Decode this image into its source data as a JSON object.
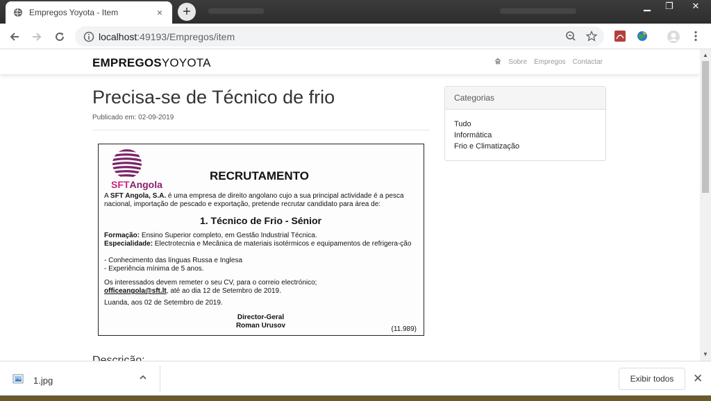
{
  "browser": {
    "tab_title": "Empregos Yoyota - Item",
    "tab_close": "×",
    "new_tab": "+",
    "url_host": "localhost",
    "url_port_path": ":49193/Empregos/item",
    "win_minimize": "▁",
    "win_restore": "❐",
    "win_close": "✕"
  },
  "site": {
    "brand_bold": "EMPREGOS",
    "brand_light": "YOYOTA",
    "nav": [
      {
        "label": "Sobre"
      },
      {
        "label": "Empregos"
      },
      {
        "label": "Contactar"
      }
    ]
  },
  "post": {
    "title": "Precisa-se de Técnico de frio",
    "published": "Publicado em: 02-09-2019",
    "description_heading": "Descrição:"
  },
  "ad": {
    "logo_a": "SFT",
    "logo_b": "Angola",
    "heading": "RECRUTAMENTO",
    "intro_a": "A ",
    "intro_company": "SFT Angola, S.A.",
    "intro_b": " é uma empresa de direito angolano cujo a sua principal actividade é a pesca nacional, importação de pescado e exportação, pretende recrutar candidato para área de:",
    "role": "1. Técnico de Frio -  Sénior",
    "formacao_label": "Formação:",
    "formacao": " Ensino Superior completo, em Gestão Industrial Técnica.",
    "especialidade_label": "Especialidade:",
    "especialidade": " Electrotecnia e Mecânica de materiais isotérmicos e equipamentos de refrigera-ção",
    "req1": "- Conhecimento das línguas Russa e Inglesa",
    "req2": "- Experiência mínima de 5 anos.",
    "contact_a": "Os interessados devem remeter o seu CV, para o correio electrónico;",
    "email": "officeangola@sft.lt",
    "contact_b": ", até ao dia 12 de Setembro de 2019.",
    "place_date": "Luanda, aos 02 de Setembro de 2019.",
    "signer_title": "Director-Geral",
    "signer_name": "Roman Urusov",
    "ref": "(11.989)"
  },
  "sidebar": {
    "heading": "Categorias",
    "items": [
      {
        "label": "Tudo"
      },
      {
        "label": "Informática"
      },
      {
        "label": "Frio e Climatização"
      }
    ]
  },
  "downloads": {
    "file_name": "1.jpg",
    "show_all": "Exibir todos",
    "close": "✕"
  }
}
